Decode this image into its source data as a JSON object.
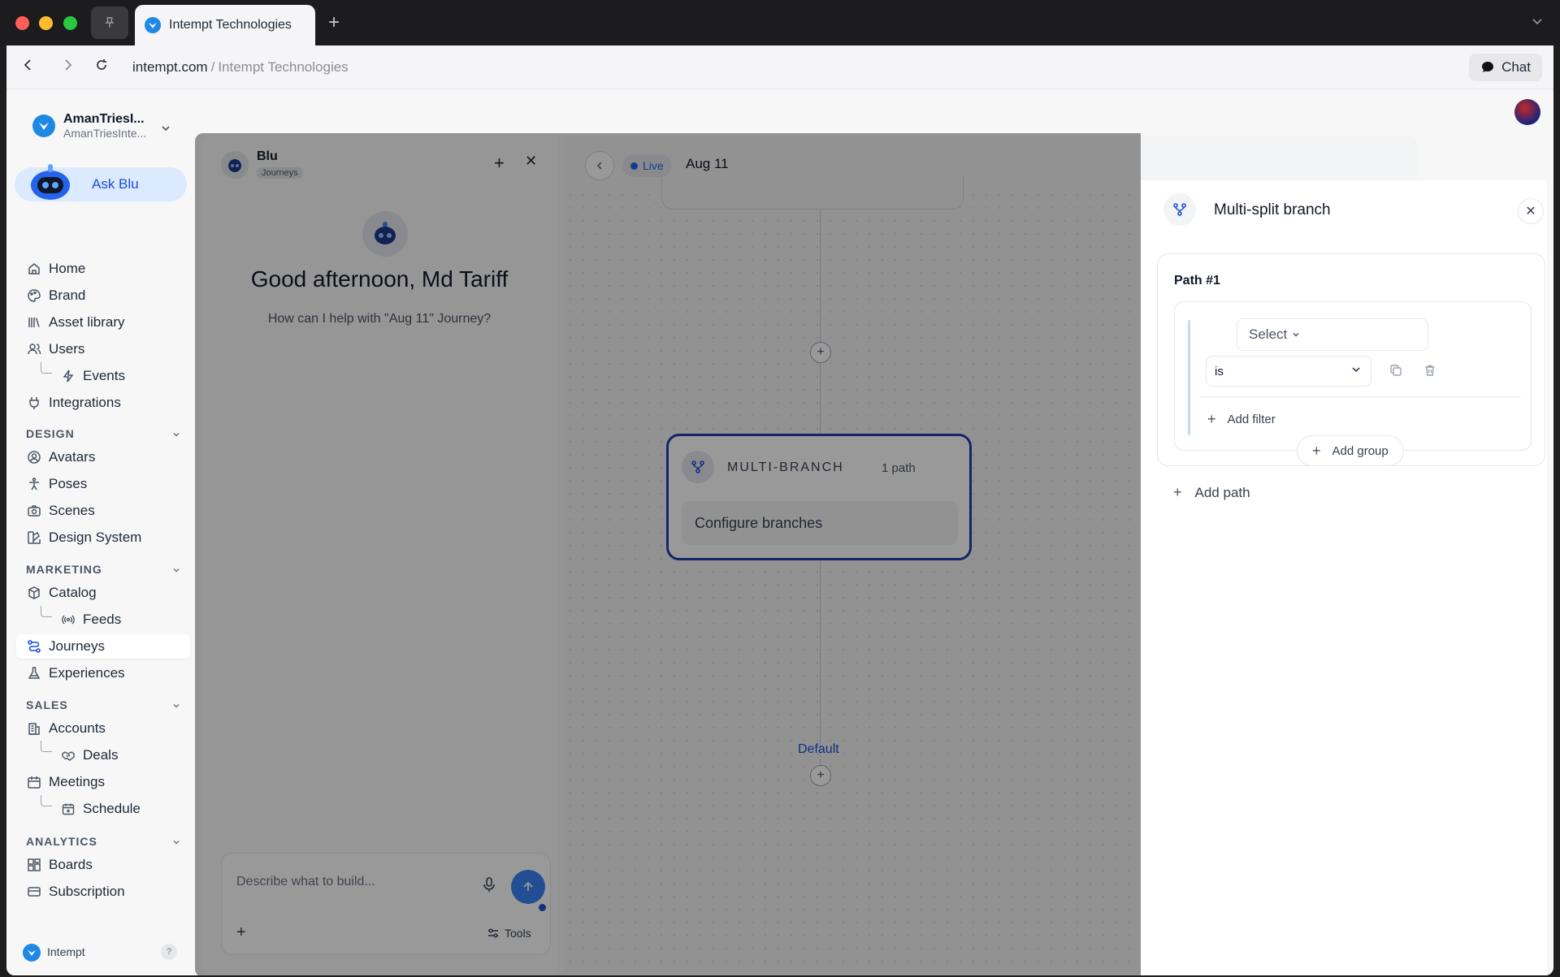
{
  "browser": {
    "tab_title": "Intempt Technologies",
    "url_host": "intempt.com",
    "url_sep": "/",
    "url_title": "Intempt Technologies",
    "chat_label": "Chat"
  },
  "workspace": {
    "name": "AmanTriesI...",
    "sub": "AmanTriesInte..."
  },
  "sidebar": {
    "ask_blu": "Ask Blu",
    "items_main": [
      {
        "label": "Home"
      },
      {
        "label": "Brand"
      },
      {
        "label": "Asset library"
      },
      {
        "label": "Users"
      },
      {
        "label": "Events"
      },
      {
        "label": "Integrations"
      }
    ],
    "design_header": "DESIGN",
    "items_design": [
      {
        "label": "Avatars"
      },
      {
        "label": "Poses"
      },
      {
        "label": "Scenes"
      },
      {
        "label": "Design System"
      }
    ],
    "marketing_header": "MARKETING",
    "items_marketing": [
      {
        "label": "Catalog"
      },
      {
        "label": "Feeds"
      },
      {
        "label": "Journeys"
      },
      {
        "label": "Experiences"
      }
    ],
    "sales_header": "SALES",
    "items_sales": [
      {
        "label": "Accounts"
      },
      {
        "label": "Deals"
      },
      {
        "label": "Meetings"
      },
      {
        "label": "Schedule"
      }
    ],
    "analytics_header": "ANALYTICS",
    "items_analytics": [
      {
        "label": "Boards"
      },
      {
        "label": "Subscription"
      }
    ],
    "footer_label": "Intempt",
    "footer_help": "?"
  },
  "blu": {
    "name": "Blu",
    "tag": "Journeys",
    "greeting": "Good afternoon, Md Tariff",
    "subtitle": "How can I help with \"Aug 11\" Journey?",
    "composer_placeholder": "Describe what to build...",
    "tools_label": "Tools"
  },
  "canvas": {
    "status": "Live",
    "title": "Aug 11",
    "node_title": "MULTI-BRANCH",
    "node_count": "1 path",
    "node_action": "Configure branches",
    "default_label": "Default"
  },
  "panel": {
    "title": "Multi-split branch",
    "path_title": "Path #1",
    "select_label": "Select",
    "operator": "is",
    "add_filter": "Add filter",
    "add_group": "Add group",
    "add_path": "Add path"
  },
  "colors": {
    "accent": "#1e40af",
    "brand": "#1e88e5",
    "live": "#2563eb"
  }
}
